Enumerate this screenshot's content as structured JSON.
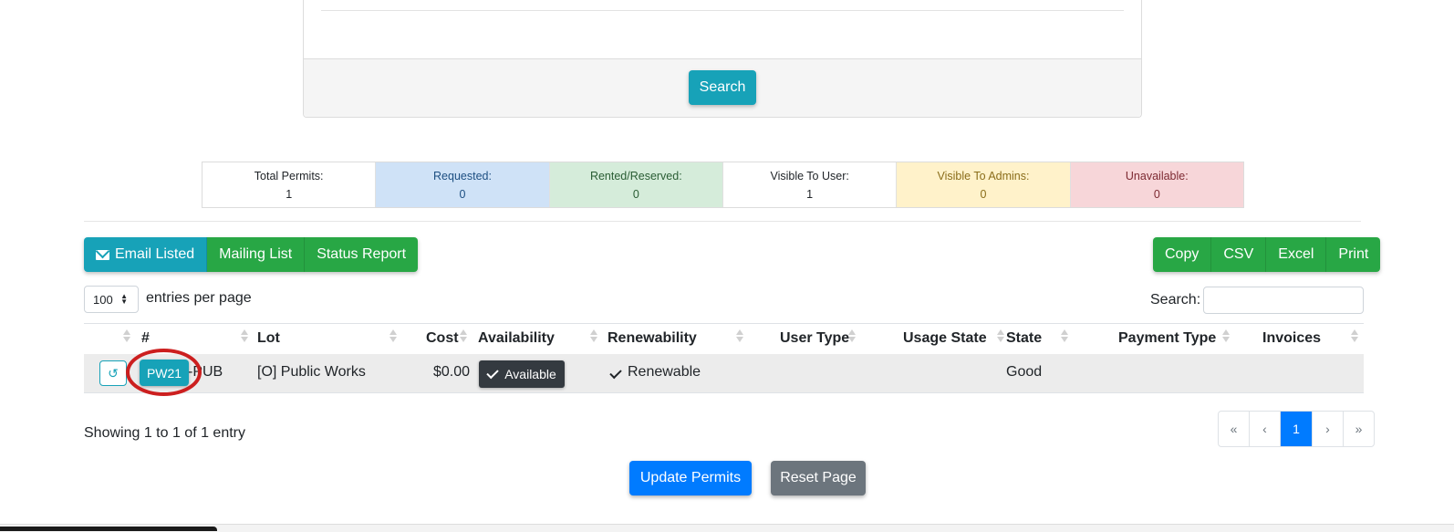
{
  "search_panel": {
    "search_label": "Search"
  },
  "stats": [
    {
      "label": "Total Permits:",
      "value": "1"
    },
    {
      "label": "Requested:",
      "value": "0"
    },
    {
      "label": "Rented/Reserved:",
      "value": "0"
    },
    {
      "label": "Visible To User:",
      "value": "1"
    },
    {
      "label": "Visible To Admins:",
      "value": "0"
    },
    {
      "label": "Unavailable:",
      "value": "0"
    }
  ],
  "toolbar": {
    "email_listed": "Email Listed",
    "mailing_list": "Mailing List",
    "status_report": "Status Report",
    "copy": "Copy",
    "csv": "CSV",
    "excel": "Excel",
    "print": "Print"
  },
  "table_controls": {
    "entries_value": "100",
    "entries_label": "entries per page",
    "search_label": "Search:",
    "search_value": ""
  },
  "table": {
    "columns": [
      "#",
      "Lot",
      "Cost",
      "Availability",
      "Renewability",
      "User Type",
      "Usage State",
      "State",
      "Payment Type",
      "Invoices"
    ],
    "rows": [
      {
        "permit_button": "PW21",
        "permit_suffix": "-PUB",
        "lot": "[O] Public Works",
        "cost": "$0.00",
        "availability": "Available",
        "renewability": "Renewable",
        "user_type": "",
        "usage_state": "",
        "state": "Good",
        "payment_type": "",
        "invoices": ""
      }
    ]
  },
  "info": "Showing 1 to 1 of 1 entry",
  "pagination": {
    "first": "«",
    "prev": "‹",
    "current": "1",
    "next": "›",
    "last": "»"
  },
  "actions": {
    "update": "Update Permits",
    "reset": "Reset Page"
  },
  "icons": {
    "email": "envelope-icon",
    "history": "history-icon",
    "check": "check-icon"
  },
  "colors": {
    "info": "#17a2b8",
    "success": "#28a745",
    "primary": "#007bff",
    "secondary": "#6c757d",
    "dark": "#343a40",
    "highlight_circle": "#cc1f1f"
  }
}
